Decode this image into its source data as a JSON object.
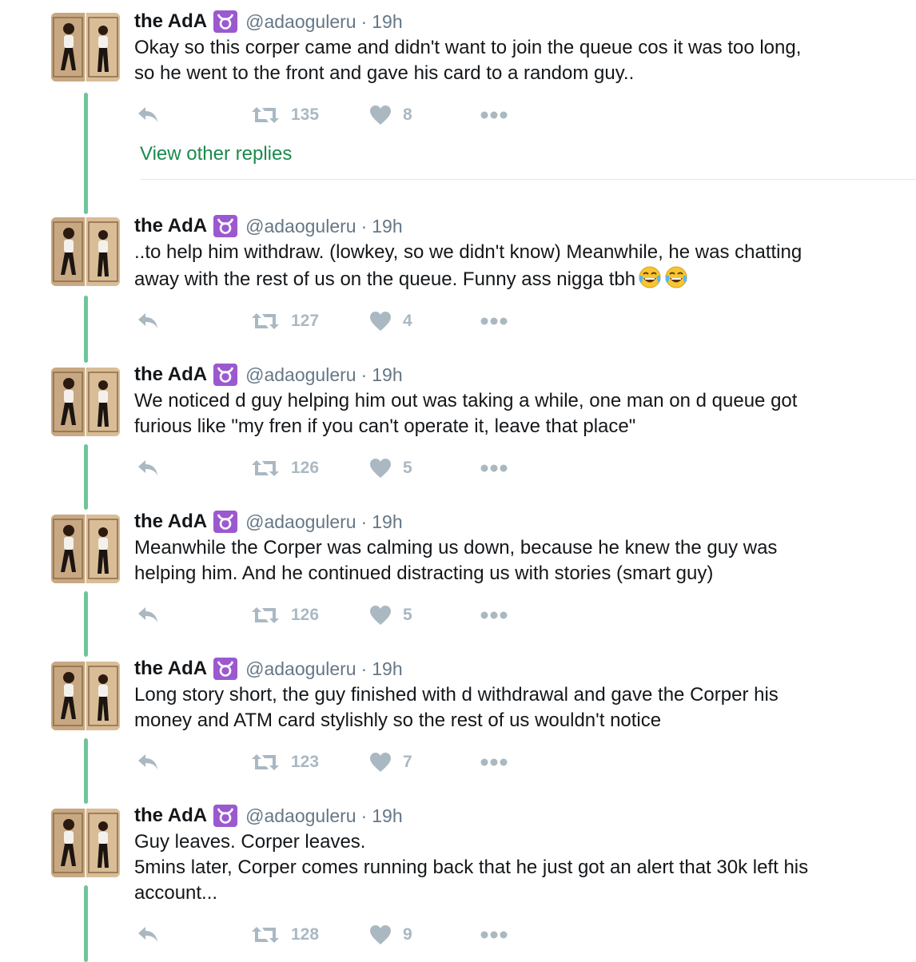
{
  "colors": {
    "thread_line": "#6fc59a",
    "badge": "#9b59d0",
    "link": "#1b8a4c",
    "muted": "#657786",
    "action": "#aab8c2"
  },
  "icons": [
    "taurus-badge-icon",
    "reply-icon",
    "retweet-icon",
    "heart-icon",
    "more-icon",
    "tears-of-joy-emoji"
  ],
  "view_other_replies": "View other replies",
  "tweets": [
    {
      "name": "the AdA",
      "handle": "@adaoguleru",
      "separator": "·",
      "time": "19h",
      "text": "Okay so this corper came and didn't want to join the queue cos it was too long,\nso he went to the front and gave his card to a random guy..",
      "retweets": "135",
      "likes": "8"
    },
    {
      "name": "the AdA",
      "handle": "@adaoguleru",
      "separator": "·",
      "time": "19h",
      "text": "..to help him withdraw. (lowkey, so we didn't know) Meanwhile, he was chatting\naway with the rest of us on the queue. Funny ass nigga tbh",
      "emoji": "tears-of-joy x2",
      "retweets": "127",
      "likes": "4"
    },
    {
      "name": "the AdA",
      "handle": "@adaoguleru",
      "separator": "·",
      "time": "19h",
      "text": "We noticed d guy helping him out was taking a while, one man on d queue got\nfurious like \"my fren if you can't operate it, leave that place\"",
      "retweets": "126",
      "likes": "5"
    },
    {
      "name": "the AdA",
      "handle": "@adaoguleru",
      "separator": "·",
      "time": "19h",
      "text": "Meanwhile the Corper was calming us down, because he knew the guy was\nhelping him. And he continued distracting us with stories (smart guy)",
      "retweets": "126",
      "likes": "5"
    },
    {
      "name": "the AdA",
      "handle": "@adaoguleru",
      "separator": "·",
      "time": "19h",
      "text": "Long story short, the guy finished with d withdrawal and gave the Corper his\nmoney and ATM card stylishly so the rest of us wouldn't notice",
      "retweets": "123",
      "likes": "7"
    },
    {
      "name": "the AdA",
      "handle": "@adaoguleru",
      "separator": "·",
      "time": "19h",
      "text": "Guy leaves. Corper leaves.\n5mins later, Corper comes running back that he just got an alert that 30k left his\naccount...",
      "retweets": "128",
      "likes": "9"
    }
  ]
}
